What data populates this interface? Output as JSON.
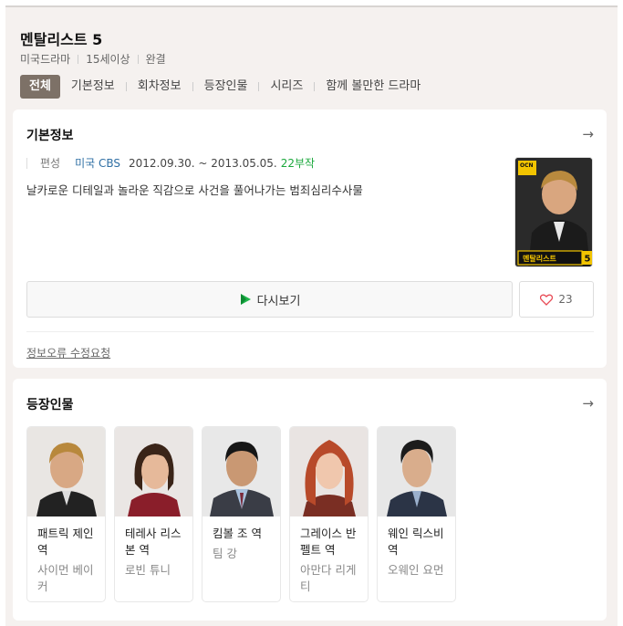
{
  "show": {
    "title": "멘탈리스트 5",
    "meta": [
      "미국드라마",
      "15세이상",
      "완결"
    ]
  },
  "tabs": [
    "전체",
    "기본정보",
    "회차정보",
    "등장인물",
    "시리즈",
    "함께 볼만한 드라마"
  ],
  "basic_info": {
    "heading": "기본정보",
    "label": "편성",
    "network": "미국 CBS",
    "dates": "2012.09.30. ~ 2013.05.05.",
    "episodes": "22부작",
    "description": "날카로운 디테일과 놀라운 직감으로 사건을 풀어나가는 범죄심리수사물",
    "poster": {
      "badge": "OCN",
      "caption": "멘탈리스트",
      "number": "5"
    },
    "watch_label": "다시보기",
    "like_count": "23",
    "report_label": "정보오류 수정요청"
  },
  "cast": {
    "heading": "등장인물",
    "members": [
      {
        "role": "패트릭 제인 역",
        "actor": "사이먼 베이커"
      },
      {
        "role": "테레사 리스본 역",
        "actor": "로빈 튜니"
      },
      {
        "role": "킴볼 조 역",
        "actor": "팀 강"
      },
      {
        "role": "그레이스 반 펠트 역",
        "actor": "아만다 리게티"
      },
      {
        "role": "웨인 릭스비 역",
        "actor": "오웨인 요먼"
      }
    ]
  },
  "icons": [
    "arrow-right-icon",
    "play-icon",
    "heart-icon"
  ],
  "colors": {
    "accent_tab": "#7d7167",
    "episodes_green": "#1ba83c",
    "network_blue": "#2f6fa4",
    "heart": "#e84a55"
  }
}
